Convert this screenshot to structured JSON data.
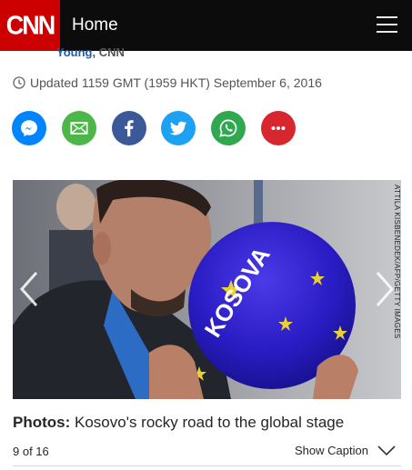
{
  "nav": {
    "logo_text": "CNN",
    "home_label": "Home",
    "menu_icon": "hamburger-menu-icon",
    "colors": {
      "bar": "#0c0c0c",
      "logo_bg": "#cc0000"
    }
  },
  "article": {
    "byline_author": "Young",
    "byline_org": ", CNN",
    "updated": "Updated 1159 GMT (1959 HKT) September 6, 2016"
  },
  "share": [
    {
      "name": "messenger-share-button",
      "icon": "messenger-icon",
      "color": "#0084ff"
    },
    {
      "name": "email-share-button",
      "icon": "email-icon",
      "color": "#4cb749"
    },
    {
      "name": "facebook-share-button",
      "icon": "facebook-icon",
      "color": "#3b5998"
    },
    {
      "name": "twitter-share-button",
      "icon": "twitter-icon",
      "color": "#1da1f2"
    },
    {
      "name": "whatsapp-share-button",
      "icon": "whatsapp-icon",
      "color": "#2fa84f"
    },
    {
      "name": "more-share-button",
      "icon": "more-icon",
      "color": "#d7262e"
    }
  ],
  "gallery": {
    "ball_text": "KOSOVA",
    "photo_credit": "ATTILA KISBENEDEK/AFP/GETTY IMAGES",
    "caption_label": "Photos:",
    "caption_text": " Kosovo's rocky road to the global stage",
    "counter": "9 of 16",
    "show_caption": "Show Caption"
  }
}
